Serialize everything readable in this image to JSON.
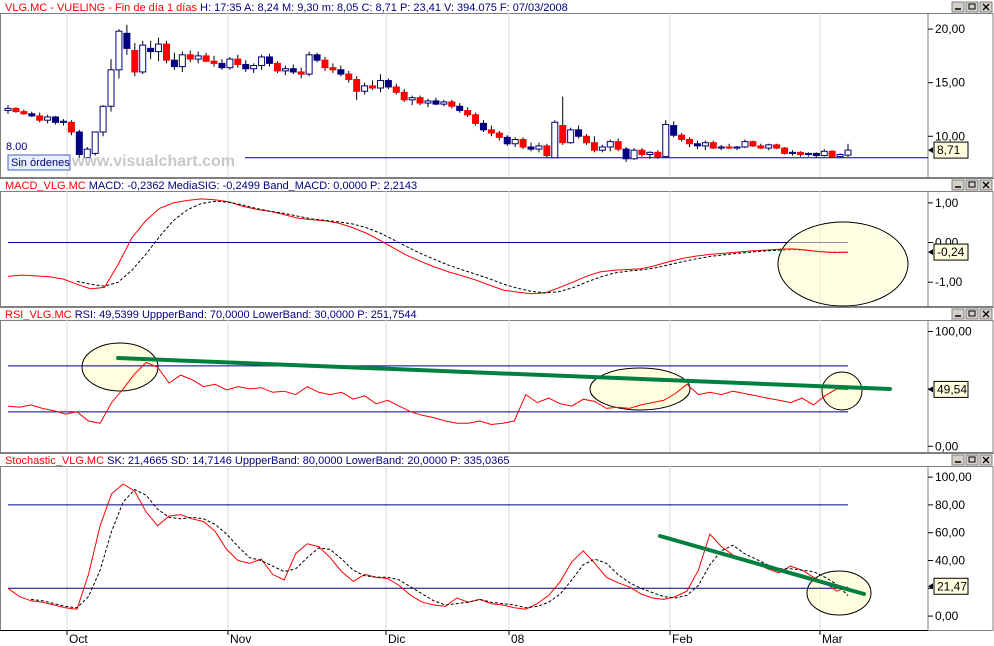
{
  "window": {
    "source": "www.visualchart.com",
    "orders_button": "Sin órdenes",
    "price_line_label": "8.00"
  },
  "x_axis": {
    "month_labels": [
      "Oct",
      "Nov",
      "Dic",
      "08",
      "Feb",
      "Mar"
    ]
  },
  "colors": {
    "bull_candle": "#ffffff",
    "bear_red": "#ff0000",
    "bear_blue": "#000080",
    "indicator_line": "#ff0000",
    "signal_line": "#000000",
    "band_line": "#000080",
    "trendline": "#008040",
    "highlight_fill": "#ffffcc"
  },
  "panels": [
    {
      "id": "price",
      "title_segments": [
        {
          "text": "VLG.MC - VUELING - Fin de día 1 días",
          "color": "#ff0000"
        },
        {
          "text": " H: 17:35  A: 8,24  M: 9,30  m: 8,05  C: 8,71  P: 23,41  V: 394.075  F: 07/03/2008",
          "color": "#000080"
        }
      ],
      "y_ticks": [
        "20,00",
        "15,00",
        "10,00"
      ],
      "last_value": "8,71"
    },
    {
      "id": "macd",
      "title_segments": [
        {
          "text": "MACD_VLG.MC",
          "color": "#ff0000"
        },
        {
          "text": "  MACD: -0,2362  MediaSIG: -0,2499  Band_MACD: 0,0000  P: 2,2143",
          "color": "#000080"
        }
      ],
      "y_ticks": [
        "1,00",
        "0,00",
        "-1,00"
      ],
      "last_value": "-0,24"
    },
    {
      "id": "rsi",
      "title_segments": [
        {
          "text": "RSI_VLG.MC",
          "color": "#ff0000"
        },
        {
          "text": "  RSI: 49,5399  UppperBand: 70,0000  LowerBand: 30,0000  P: 251,7544",
          "color": "#000080"
        }
      ],
      "y_ticks": [
        "100,00",
        "50,00",
        "0,00"
      ],
      "last_value": "49,54"
    },
    {
      "id": "stoch",
      "title_segments": [
        {
          "text": "Stochastic_VLG.MC",
          "color": "#ff0000"
        },
        {
          "text": "  SK: 21,4665  SD: 14,7146  UppperBand: 80,0000  LowerBand: 20,0000  P: 335,0365",
          "color": "#000080"
        }
      ],
      "y_ticks": [
        "100,00",
        "80,00",
        "60,00",
        "40,00",
        "20,00",
        "0,00"
      ],
      "last_value": "21,47"
    }
  ],
  "chart_data": [
    {
      "type": "candlestick",
      "panel": "price",
      "ylim": [
        6.2,
        21.5
      ],
      "y_ticks": [
        20,
        15,
        10
      ],
      "hline": 8.0,
      "candles_ohlc": [
        [
          12.4,
          12.9,
          12.1,
          12.6
        ],
        [
          12.6,
          12.7,
          12.2,
          12.3
        ],
        [
          12.3,
          12.5,
          12.0,
          12.1
        ],
        [
          12.1,
          12.3,
          11.8,
          11.9
        ],
        [
          11.9,
          12.2,
          11.3,
          11.5
        ],
        [
          11.5,
          12.0,
          11.2,
          11.8
        ],
        [
          11.8,
          11.9,
          11.1,
          11.3
        ],
        [
          11.3,
          11.6,
          11.0,
          11.4
        ],
        [
          11.3,
          11.5,
          10.1,
          10.4
        ],
        [
          10.4,
          10.6,
          8.0,
          8.3
        ],
        [
          8.0,
          9.0,
          8.0,
          8.8
        ],
        [
          8.4,
          10.4,
          8.2,
          10.4
        ],
        [
          10.4,
          12.9,
          10.0,
          12.8
        ],
        [
          12.8,
          17.2,
          12.3,
          16.2
        ],
        [
          16.2,
          20.0,
          15.4,
          19.8
        ],
        [
          19.6,
          20.4,
          17.6,
          18.2
        ],
        [
          18.0,
          18.7,
          15.6,
          16.0
        ],
        [
          16.0,
          18.9,
          15.8,
          18.5
        ],
        [
          18.2,
          18.9,
          17.2,
          17.9
        ],
        [
          17.9,
          19.2,
          17.0,
          18.6
        ],
        [
          18.6,
          18.9,
          16.8,
          17.1
        ],
        [
          17.1,
          17.8,
          16.2,
          16.5
        ],
        [
          16.5,
          17.9,
          16.0,
          17.6
        ],
        [
          17.6,
          18.0,
          16.9,
          17.2
        ],
        [
          17.2,
          17.9,
          16.8,
          17.5
        ],
        [
          17.5,
          17.8,
          16.9,
          17.0
        ],
        [
          17.0,
          17.5,
          16.5,
          16.8
        ],
        [
          16.8,
          17.2,
          16.2,
          16.4
        ],
        [
          16.4,
          17.4,
          16.2,
          17.2
        ],
        [
          17.2,
          17.6,
          16.4,
          16.7
        ],
        [
          16.7,
          17.1,
          16.0,
          16.3
        ],
        [
          16.3,
          16.8,
          15.9,
          16.6
        ],
        [
          16.6,
          17.6,
          16.2,
          17.4
        ],
        [
          17.4,
          17.7,
          16.5,
          16.8
        ],
        [
          16.8,
          17.0,
          15.9,
          16.1
        ],
        [
          16.1,
          16.6,
          15.7,
          16.3
        ],
        [
          16.3,
          16.7,
          15.8,
          16.0
        ],
        [
          16.0,
          16.4,
          15.4,
          15.8
        ],
        [
          15.8,
          17.9,
          15.6,
          17.6
        ],
        [
          17.6,
          17.8,
          16.9,
          17.1
        ],
        [
          17.1,
          17.4,
          16.1,
          16.4
        ],
        [
          16.4,
          16.8,
          15.9,
          16.2
        ],
        [
          16.2,
          16.6,
          15.6,
          15.8
        ],
        [
          15.8,
          16.1,
          15.0,
          15.3
        ],
        [
          15.3,
          15.6,
          13.4,
          14.2
        ],
        [
          14.2,
          15.0,
          13.9,
          14.7
        ],
        [
          14.7,
          15.2,
          14.3,
          14.5
        ],
        [
          14.5,
          15.8,
          14.1,
          15.2
        ],
        [
          15.2,
          15.4,
          14.4,
          14.6
        ],
        [
          14.6,
          14.9,
          13.9,
          14.1
        ],
        [
          14.1,
          14.4,
          13.2,
          13.4
        ],
        [
          13.4,
          13.8,
          12.9,
          13.6
        ],
        [
          13.6,
          13.8,
          12.9,
          13.1
        ],
        [
          13.1,
          13.5,
          12.7,
          13.3
        ],
        [
          13.3,
          13.6,
          12.9,
          13.0
        ],
        [
          13.0,
          13.4,
          12.8,
          13.2
        ],
        [
          13.2,
          13.4,
          12.6,
          12.8
        ],
        [
          12.8,
          13.1,
          12.2,
          12.4
        ],
        [
          12.4,
          12.7,
          11.8,
          12.0
        ],
        [
          12.0,
          12.2,
          11.0,
          11.2
        ],
        [
          11.2,
          11.5,
          10.4,
          10.6
        ],
        [
          10.6,
          11.0,
          10.0,
          10.3
        ],
        [
          10.3,
          10.5,
          9.6,
          9.9
        ],
        [
          9.9,
          10.1,
          9.1,
          9.3
        ],
        [
          9.3,
          9.9,
          9.0,
          9.7
        ],
        [
          9.7,
          9.9,
          8.8,
          9.0
        ],
        [
          9.0,
          9.4,
          8.6,
          8.8
        ],
        [
          8.8,
          9.4,
          8.5,
          9.1
        ],
        [
          9.1,
          9.3,
          8.0,
          8.2
        ],
        [
          8.0,
          11.5,
          8.0,
          11.3
        ],
        [
          11.0,
          13.7,
          9.2,
          9.4
        ],
        [
          9.4,
          10.8,
          9.3,
          10.6
        ],
        [
          10.6,
          11.0,
          9.8,
          10.0
        ],
        [
          10.0,
          10.2,
          9.2,
          9.4
        ],
        [
          9.4,
          10.0,
          8.5,
          8.7
        ],
        [
          8.7,
          9.2,
          8.5,
          9.0
        ],
        [
          9.0,
          9.7,
          8.6,
          9.5
        ],
        [
          9.5,
          9.8,
          8.6,
          8.8
        ],
        [
          8.8,
          9.0,
          7.6,
          7.9
        ],
        [
          7.9,
          8.9,
          7.8,
          8.7
        ],
        [
          8.7,
          8.9,
          8.1,
          8.3
        ],
        [
          8.3,
          8.6,
          7.9,
          8.5
        ],
        [
          8.5,
          8.7,
          7.9,
          8.1
        ],
        [
          8.1,
          11.5,
          8.0,
          11.1
        ],
        [
          11.0,
          11.4,
          9.9,
          10.1
        ],
        [
          10.1,
          10.3,
          9.5,
          9.7
        ],
        [
          9.7,
          9.9,
          9.0,
          9.3
        ],
        [
          9.3,
          9.6,
          8.8,
          9.1
        ],
        [
          9.1,
          9.6,
          8.7,
          9.4
        ],
        [
          9.4,
          9.6,
          8.8,
          8.9
        ],
        [
          8.9,
          9.2,
          8.7,
          9.0
        ],
        [
          9.0,
          9.3,
          8.8,
          8.9
        ],
        [
          8.9,
          9.1,
          8.7,
          9.0
        ],
        [
          9.0,
          9.7,
          8.9,
          9.5
        ],
        [
          9.5,
          9.6,
          9.0,
          9.1
        ],
        [
          9.1,
          9.3,
          8.8,
          8.9
        ],
        [
          8.9,
          9.3,
          8.7,
          9.2
        ],
        [
          9.2,
          9.3,
          8.8,
          8.9
        ],
        [
          8.9,
          9.0,
          8.3,
          8.4
        ],
        [
          8.4,
          8.7,
          8.2,
          8.5
        ],
        [
          8.5,
          8.6,
          8.1,
          8.3
        ],
        [
          8.3,
          8.5,
          8.1,
          8.4
        ],
        [
          8.4,
          8.5,
          8.0,
          8.2
        ],
        [
          8.2,
          8.8,
          8.1,
          8.6
        ],
        [
          8.6,
          8.7,
          8.0,
          8.1
        ],
        [
          8.1,
          8.4,
          8.0,
          8.3
        ],
        [
          8.24,
          9.3,
          8.05,
          8.71
        ]
      ]
    },
    {
      "type": "line",
      "panel": "macd",
      "ylim": [
        -1.6,
        1.3
      ],
      "y_ticks": [
        1,
        0,
        -1
      ],
      "band": 0,
      "series": [
        {
          "name": "MACD",
          "values": [
            -0.85,
            -0.82,
            -0.84,
            -0.86,
            -0.92,
            -1.05,
            -1.17,
            -1.13,
            -0.55,
            0.12,
            0.55,
            0.86,
            1.0,
            1.06,
            1.1,
            1.08,
            1.03,
            0.92,
            0.84,
            0.79,
            0.71,
            0.62,
            0.58,
            0.55,
            0.49,
            0.38,
            0.24,
            0.06,
            -0.14,
            -0.33,
            -0.48,
            -0.62,
            -0.74,
            -0.84,
            -0.95,
            -1.08,
            -1.2,
            -1.25,
            -1.29,
            -1.27,
            -1.14,
            -1.0,
            -0.85,
            -0.74,
            -0.7,
            -0.68,
            -0.66,
            -0.58,
            -0.48,
            -0.4,
            -0.34,
            -0.3,
            -0.27,
            -0.24,
            -0.21,
            -0.19,
            -0.17,
            -0.16,
            -0.19,
            -0.23,
            -0.25,
            -0.24
          ]
        },
        {
          "name": "MediaSIG",
          "values": [
            null,
            null,
            null,
            null,
            null,
            -0.98,
            -1.05,
            -1.1,
            -1.0,
            -0.7,
            -0.3,
            0.15,
            0.55,
            0.82,
            0.98,
            1.04,
            1.02,
            0.95,
            0.86,
            0.79,
            0.74,
            0.67,
            0.6,
            0.56,
            0.52,
            0.47,
            0.38,
            0.24,
            0.07,
            -0.11,
            -0.28,
            -0.43,
            -0.57,
            -0.69,
            -0.8,
            -0.92,
            -1.05,
            -1.15,
            -1.23,
            -1.27,
            -1.24,
            -1.14,
            -1.0,
            -0.87,
            -0.77,
            -0.72,
            -0.69,
            -0.64,
            -0.56,
            -0.48,
            -0.41,
            -0.35,
            -0.31,
            -0.27,
            -0.24,
            -0.21,
            -0.19,
            -0.18,
            -0.2,
            -0.23,
            -0.24,
            -0.25
          ]
        }
      ]
    },
    {
      "type": "line",
      "panel": "rsi",
      "ylim": [
        -5,
        110
      ],
      "y_ticks": [
        100,
        50,
        0
      ],
      "bands": [
        70,
        30
      ],
      "series": [
        {
          "name": "RSI",
          "values": [
            35,
            34,
            36,
            33,
            31,
            28,
            30,
            22,
            20,
            38,
            50,
            63,
            73,
            69,
            55,
            62,
            58,
            52,
            54,
            49,
            52,
            50,
            51,
            47,
            48,
            45,
            52,
            47,
            45,
            47,
            41,
            44,
            37,
            40,
            35,
            30,
            27,
            25,
            22,
            20,
            20,
            22,
            19,
            20,
            22,
            45,
            38,
            42,
            37,
            35,
            41,
            39,
            33,
            34,
            33,
            36,
            38,
            40,
            46,
            54,
            45,
            47,
            45,
            48,
            46,
            44,
            42,
            40,
            38,
            42,
            36,
            44,
            50,
            49.5
          ]
        }
      ]
    },
    {
      "type": "line",
      "panel": "stoch",
      "ylim": [
        -10,
        108
      ],
      "y_ticks": [
        100,
        80,
        60,
        40,
        20,
        0
      ],
      "bands": [
        80,
        20
      ],
      "series": [
        {
          "name": "SK",
          "values": [
            20,
            14,
            11,
            10,
            8,
            6,
            5,
            30,
            65,
            88,
            95,
            90,
            75,
            65,
            72,
            73,
            70,
            68,
            61,
            48,
            40,
            38,
            41,
            30,
            26,
            45,
            52,
            50,
            42,
            32,
            25,
            30,
            28,
            27,
            22,
            15,
            10,
            8,
            7,
            13,
            10,
            12,
            9,
            8,
            6,
            5,
            9,
            15,
            25,
            39,
            47,
            38,
            28,
            24,
            21,
            16,
            13,
            12,
            14,
            18,
            33,
            59,
            50,
            44,
            40,
            38,
            34,
            31,
            36,
            33,
            28,
            24,
            18,
            21
          ]
        },
        {
          "name": "SD",
          "values": [
            null,
            null,
            12,
            11,
            9,
            7,
            6,
            14,
            33,
            61,
            82,
            91,
            87,
            77,
            71,
            70,
            71,
            70,
            66,
            59,
            50,
            42,
            40,
            36,
            32,
            34,
            42,
            49,
            48,
            41,
            33,
            29,
            28,
            28,
            26,
            21,
            16,
            11,
            8,
            9,
            10,
            12,
            10,
            9,
            8,
            6,
            7,
            10,
            16,
            26,
            37,
            41,
            38,
            30,
            24,
            20,
            17,
            14,
            13,
            15,
            22,
            37,
            47,
            51,
            45,
            41,
            37,
            34,
            34,
            33,
            32,
            28,
            23,
            14.7
          ]
        }
      ]
    }
  ]
}
